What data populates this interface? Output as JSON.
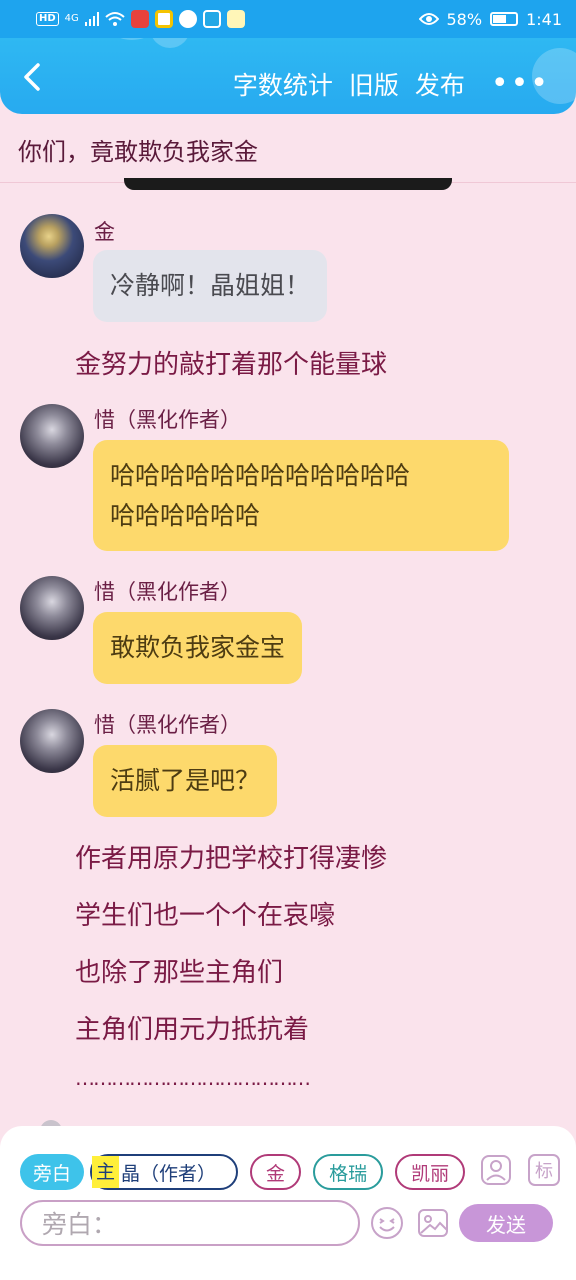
{
  "status_bar": {
    "hd": "HD",
    "network": "4G",
    "network_sub": "4G",
    "battery_percent": "58%",
    "battery_level": 0.58,
    "time": "1:41"
  },
  "header": {
    "word_count": "字数统计",
    "old_version": "旧版",
    "publish": "发布",
    "more": "•••"
  },
  "story_title": "你们，竟敢欺负我家金",
  "messages": [
    {
      "sender": "金",
      "bubble_lines": [
        "冷静啊！晶姐姐！"
      ],
      "style": "gray",
      "avatar_color": "#2e3a63"
    },
    {
      "narration": "金努力的敲打着那个能量球"
    },
    {
      "sender": "惜（黑化作者）",
      "bubble_lines": [
        "哈哈哈哈哈哈哈哈哈哈哈哈",
        "哈哈哈哈哈哈"
      ],
      "style": "yellow",
      "avatar_color": "#4a4657"
    },
    {
      "sender": "惜（黑化作者）",
      "bubble_lines": [
        "敢欺负我家金宝"
      ],
      "style": "yellow",
      "avatar_color": "#4a4657"
    },
    {
      "sender": "惜（黑化作者）",
      "bubble_lines": [
        "活腻了是吧？"
      ],
      "style": "yellow",
      "avatar_color": "#4a4657"
    },
    {
      "narration": "作者用原力把学校打得凄惨"
    },
    {
      "narration": "学生们也一个个在哀嚎"
    },
    {
      "narration": "也除了那些主角们"
    },
    {
      "narration": "主角们用元力抵抗着"
    },
    {
      "narration": "…………………………………"
    }
  ],
  "composer": {
    "chips": {
      "narrator": "旁白",
      "main_tag": "主",
      "main": "晶（作者）",
      "jin": "金",
      "gerui": "格瑞",
      "kaili": "凯丽"
    },
    "icons": [
      "person-icon",
      "tag-icon",
      "emoji-icon",
      "image-icon"
    ],
    "tag_icon_text": "标",
    "input_placeholder": "旁白：",
    "send": "发送"
  },
  "colors": {
    "header_blue": "#27aaf0",
    "page_pink": "#fae3ec",
    "bubble_yellow": "#fdd96c",
    "bubble_gray": "#e3e4ec",
    "send_purple": "#c896d8",
    "narrator_chip": "#3ec3ea"
  }
}
